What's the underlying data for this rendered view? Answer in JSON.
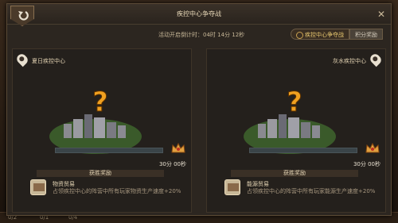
{
  "title": "疾控中心争夺战",
  "countdown": "活动开启倒计时：04时 14分 12秒",
  "tabs": [
    {
      "label": "疾控中心争夺战",
      "active": true
    },
    {
      "label": "积分奖励",
      "active": false
    }
  ],
  "panels": [
    {
      "name": "夏日疾控中心",
      "progress": 0,
      "time": "30分 00秒",
      "reward_header": "获胜奖励",
      "reward_name": "物资贸易",
      "reward_desc": "占领疾控中心的阵营中所有玩家物资生产速度+20%"
    },
    {
      "name": "灰水疾控中心",
      "progress": 0,
      "time": "30分 00秒",
      "reward_header": "获胜奖励",
      "reward_name": "能源贸易",
      "reward_desc": "占领疾控中心的阵营中所有玩家能源生产速度+20%"
    }
  ],
  "bottom_strip": [
    "0/2",
    "0/1",
    "0/4"
  ],
  "colors": {
    "accent": "#e8c870",
    "question": "#f0a020",
    "progress": "#6aa0b0"
  }
}
